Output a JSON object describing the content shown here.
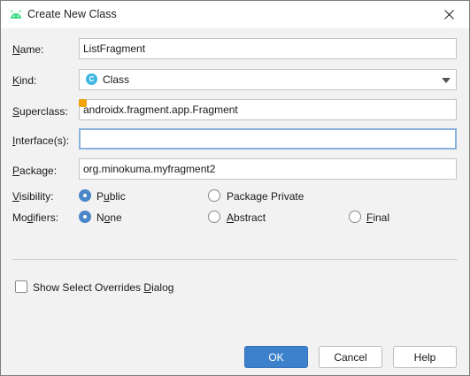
{
  "window": {
    "title": "Create New Class"
  },
  "form": {
    "name": {
      "label_u": "N",
      "label_rest": "ame:",
      "value": "ListFragment"
    },
    "kind": {
      "label_u": "K",
      "label_rest": "ind:",
      "value": "Class",
      "badge": "C"
    },
    "superclass": {
      "label_u": "S",
      "label_rest": "uperclass:",
      "value": "androidx.fragment.app.Fragment"
    },
    "interfaces": {
      "label_u": "I",
      "label_rest": "nterface(s):",
      "value": ""
    },
    "package": {
      "label_u": "P",
      "label_rest": "ackage:",
      "value": "org.minokuma.myfragment2"
    },
    "visibility": {
      "label_u": "V",
      "label_rest": "isibility:",
      "options": [
        {
          "pre": "P",
          "u": "u",
          "post": "blic",
          "selected": true
        },
        {
          "pre": "Package Private",
          "u": "",
          "post": "",
          "selected": false
        }
      ]
    },
    "modifiers": {
      "label_pre": "Mo",
      "label_u": "d",
      "label_rest": "ifiers:",
      "options": [
        {
          "pre": "N",
          "u": "o",
          "post": "ne",
          "selected": true
        },
        {
          "pre": "",
          "u": "A",
          "post": "bstract",
          "selected": false
        },
        {
          "pre": "",
          "u": "F",
          "post": "inal",
          "selected": false
        }
      ]
    },
    "overrides": {
      "pre": "Show Select Overrides ",
      "u": "D",
      "post": "ialog",
      "checked": false
    }
  },
  "buttons": {
    "ok": "OK",
    "cancel": "Cancel",
    "help": "Help"
  },
  "colors": {
    "accent": "#3d80cc",
    "android": "#3ddc84",
    "warning": "#f0a30a"
  }
}
